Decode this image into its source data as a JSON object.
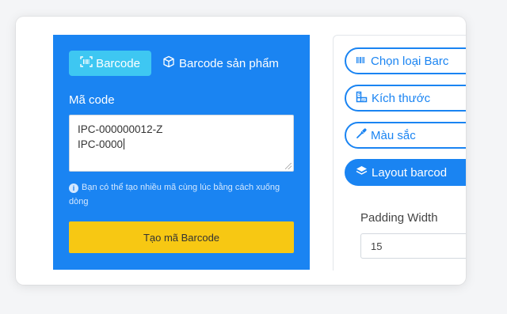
{
  "tabs": {
    "barcode": "Barcode",
    "product_barcode": "Barcode sản phẩm"
  },
  "code_field": {
    "label": "Mã code",
    "lines": [
      "IPC-000000012-Z",
      "IPC-0000"
    ]
  },
  "hint": "Bạn có thể tạo nhiều mã cùng lúc bằng cách xuống dòng",
  "generate_button": "Tạo mã Barcode",
  "settings_menu": {
    "type": "Chọn loại Barc",
    "size": "Kích thước",
    "color": "Màu sắc",
    "layout": "Layout barcod"
  },
  "padding": {
    "label": "Padding Width",
    "value": "15"
  },
  "colors": {
    "panel_blue": "#1a84f2",
    "tab_active": "#3ec7f2",
    "button_yellow": "#f7c813"
  },
  "icons": [
    "barcode-scan-icon",
    "box-icon",
    "info-icon",
    "barcode-icon",
    "ruler-icon",
    "eyedropper-icon",
    "layers-icon"
  ]
}
